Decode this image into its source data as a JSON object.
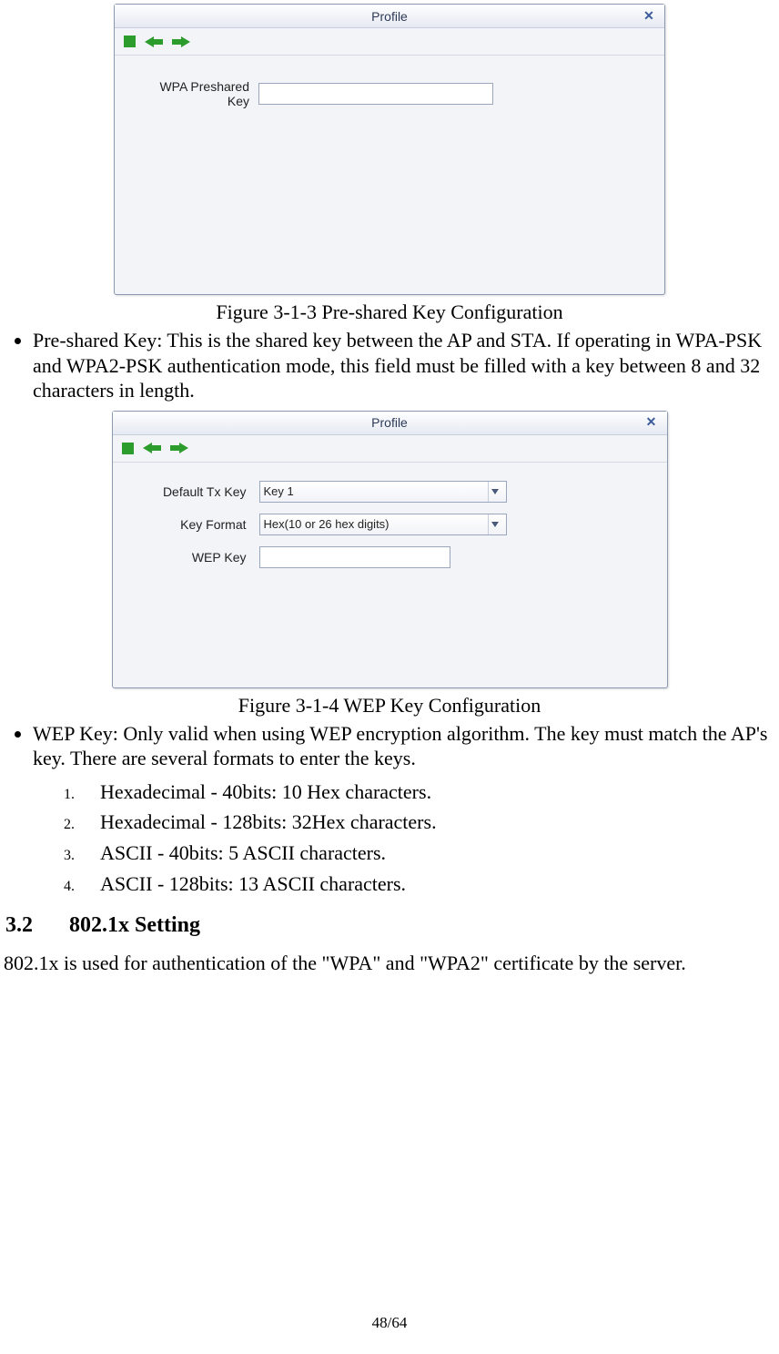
{
  "dialog1": {
    "title": "Profile",
    "wpa_label": "WPA Preshared Key",
    "wpa_value": ""
  },
  "caption1": "Figure 3-1-3 Pre-shared Key Configuration",
  "bullet_pre_shared": "Pre-shared Key: This is the shared key between the AP and STA. If operating in WPA-PSK and WPA2-PSK authentication mode, this field must be filled with a key between 8 and 32 characters in length.",
  "dialog2": {
    "title": "Profile",
    "default_tx_label": "Default Tx Key",
    "default_tx_value": "Key 1",
    "key_format_label": "Key Format",
    "key_format_value": "Hex(10 or 26 hex digits)",
    "wep_key_label": "WEP Key",
    "wep_key_value": ""
  },
  "caption2": "Figure 3-1-4 WEP Key Configuration",
  "bullet_wep": "WEP Key: Only valid when using WEP encryption algorithm. The key must match the AP's key. There are several formats to enter the keys.",
  "sublist": {
    "n1": "1.",
    "t1": "Hexadecimal - 40bits: 10 Hex characters.",
    "n2": "2.",
    "t2": "Hexadecimal - 128bits: 32Hex characters.",
    "n3": "3.",
    "t3": "ASCII - 40bits: 5 ASCII characters.",
    "n4": "4.",
    "t4": "ASCII - 128bits: 13 ASCII characters."
  },
  "section": {
    "no": "3.2",
    "title": "802.1x Setting"
  },
  "section_para": "802.1x is used for authentication of the \"WPA\" and \"WPA2\" certificate by the server.",
  "page_num": "48/64"
}
